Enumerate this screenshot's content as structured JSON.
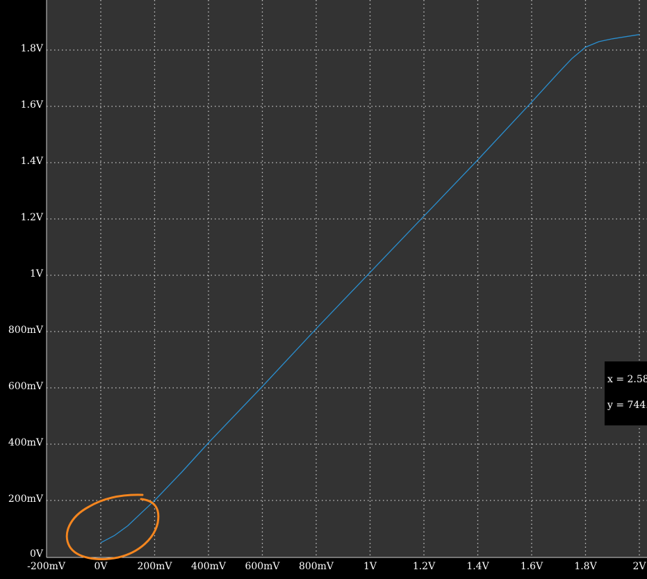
{
  "colors": {
    "background": "#000000",
    "plot_area": "#333333",
    "grid": "#c8c8c8",
    "trace": "#2a8fd0",
    "annotation": "#f5861f",
    "text": "#ffffff"
  },
  "readout": {
    "x_text": "x = 2.58",
    "y_text": "y = 744."
  },
  "chart_data": {
    "type": "line",
    "title": "",
    "xlabel": "",
    "ylabel": "",
    "xlim": [
      -0.2,
      2.0
    ],
    "ylim": [
      0,
      1.8
    ],
    "grid": true,
    "x_ticks": [
      {
        "value": -0.2,
        "label": "-200mV"
      },
      {
        "value": 0,
        "label": "0V"
      },
      {
        "value": 0.2,
        "label": "200mV"
      },
      {
        "value": 0.4,
        "label": "400mV"
      },
      {
        "value": 0.6,
        "label": "600mV"
      },
      {
        "value": 0.8,
        "label": "800mV"
      },
      {
        "value": 1.0,
        "label": "1V"
      },
      {
        "value": 1.2,
        "label": "1.2V"
      },
      {
        "value": 1.4,
        "label": "1.4V"
      },
      {
        "value": 1.6,
        "label": "1.6V"
      },
      {
        "value": 1.8,
        "label": "1.8V"
      },
      {
        "value": 2.0,
        "label": "2V"
      }
    ],
    "y_ticks": [
      {
        "value": 0,
        "label": "0V"
      },
      {
        "value": 0.2,
        "label": "200mV"
      },
      {
        "value": 0.4,
        "label": "400mV"
      },
      {
        "value": 0.6,
        "label": "600mV"
      },
      {
        "value": 0.8,
        "label": "800mV"
      },
      {
        "value": 1.0,
        "label": "1V"
      },
      {
        "value": 1.2,
        "label": "1.2V"
      },
      {
        "value": 1.4,
        "label": "1.4V"
      },
      {
        "value": 1.6,
        "label": "1.6V"
      },
      {
        "value": 1.8,
        "label": "1.8V"
      }
    ],
    "series": [
      {
        "color": "#2a8fd0",
        "x": [
          0.0,
          0.05,
          0.1,
          0.15,
          0.2,
          0.3,
          0.4,
          0.6,
          0.8,
          1.0,
          1.2,
          1.4,
          1.6,
          1.7,
          1.75,
          1.8,
          1.85,
          1.9,
          2.0
        ],
        "y": [
          0.05,
          0.075,
          0.11,
          0.155,
          0.2,
          0.3,
          0.405,
          0.605,
          0.81,
          1.01,
          1.21,
          1.41,
          1.615,
          1.72,
          1.77,
          1.81,
          1.83,
          1.84,
          1.855
        ]
      }
    ]
  }
}
